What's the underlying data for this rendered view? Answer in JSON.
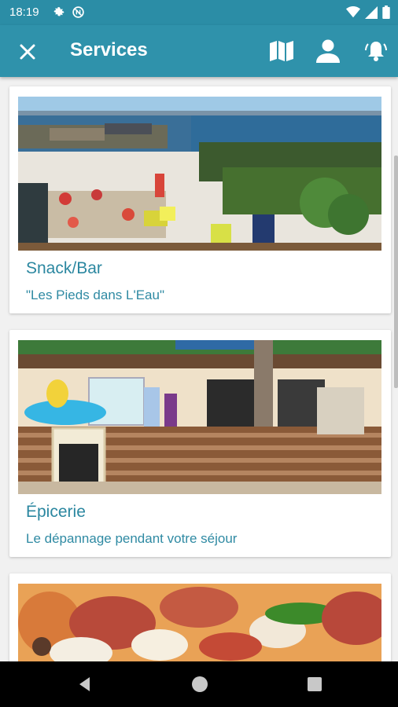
{
  "status_bar": {
    "time": "18:19",
    "left_icons": [
      "gear-icon",
      "no-sim-icon"
    ],
    "right_icons": [
      "wifi-icon",
      "signal-icon",
      "battery-icon"
    ]
  },
  "app_bar": {
    "title": "Services",
    "background": "#2f92ab",
    "actions": [
      "map-icon",
      "user-icon",
      "notification-bell-icon"
    ]
  },
  "cards": [
    {
      "title": "Snack/Bar",
      "subtitle": "\"Les Pieds dans L'Eau\"",
      "image": "beach-bar-photo"
    },
    {
      "title": "Épicerie",
      "subtitle": "Le dépannage pendant votre séjour",
      "image": "grocery-store-photo"
    },
    {
      "title": "",
      "subtitle": "",
      "image": "pizza-photo"
    }
  ],
  "nav_bar": {
    "buttons": [
      "back-icon",
      "home-icon",
      "recents-icon"
    ]
  },
  "colors": {
    "accent": "#2b87a0",
    "status": "#2b8da6"
  }
}
